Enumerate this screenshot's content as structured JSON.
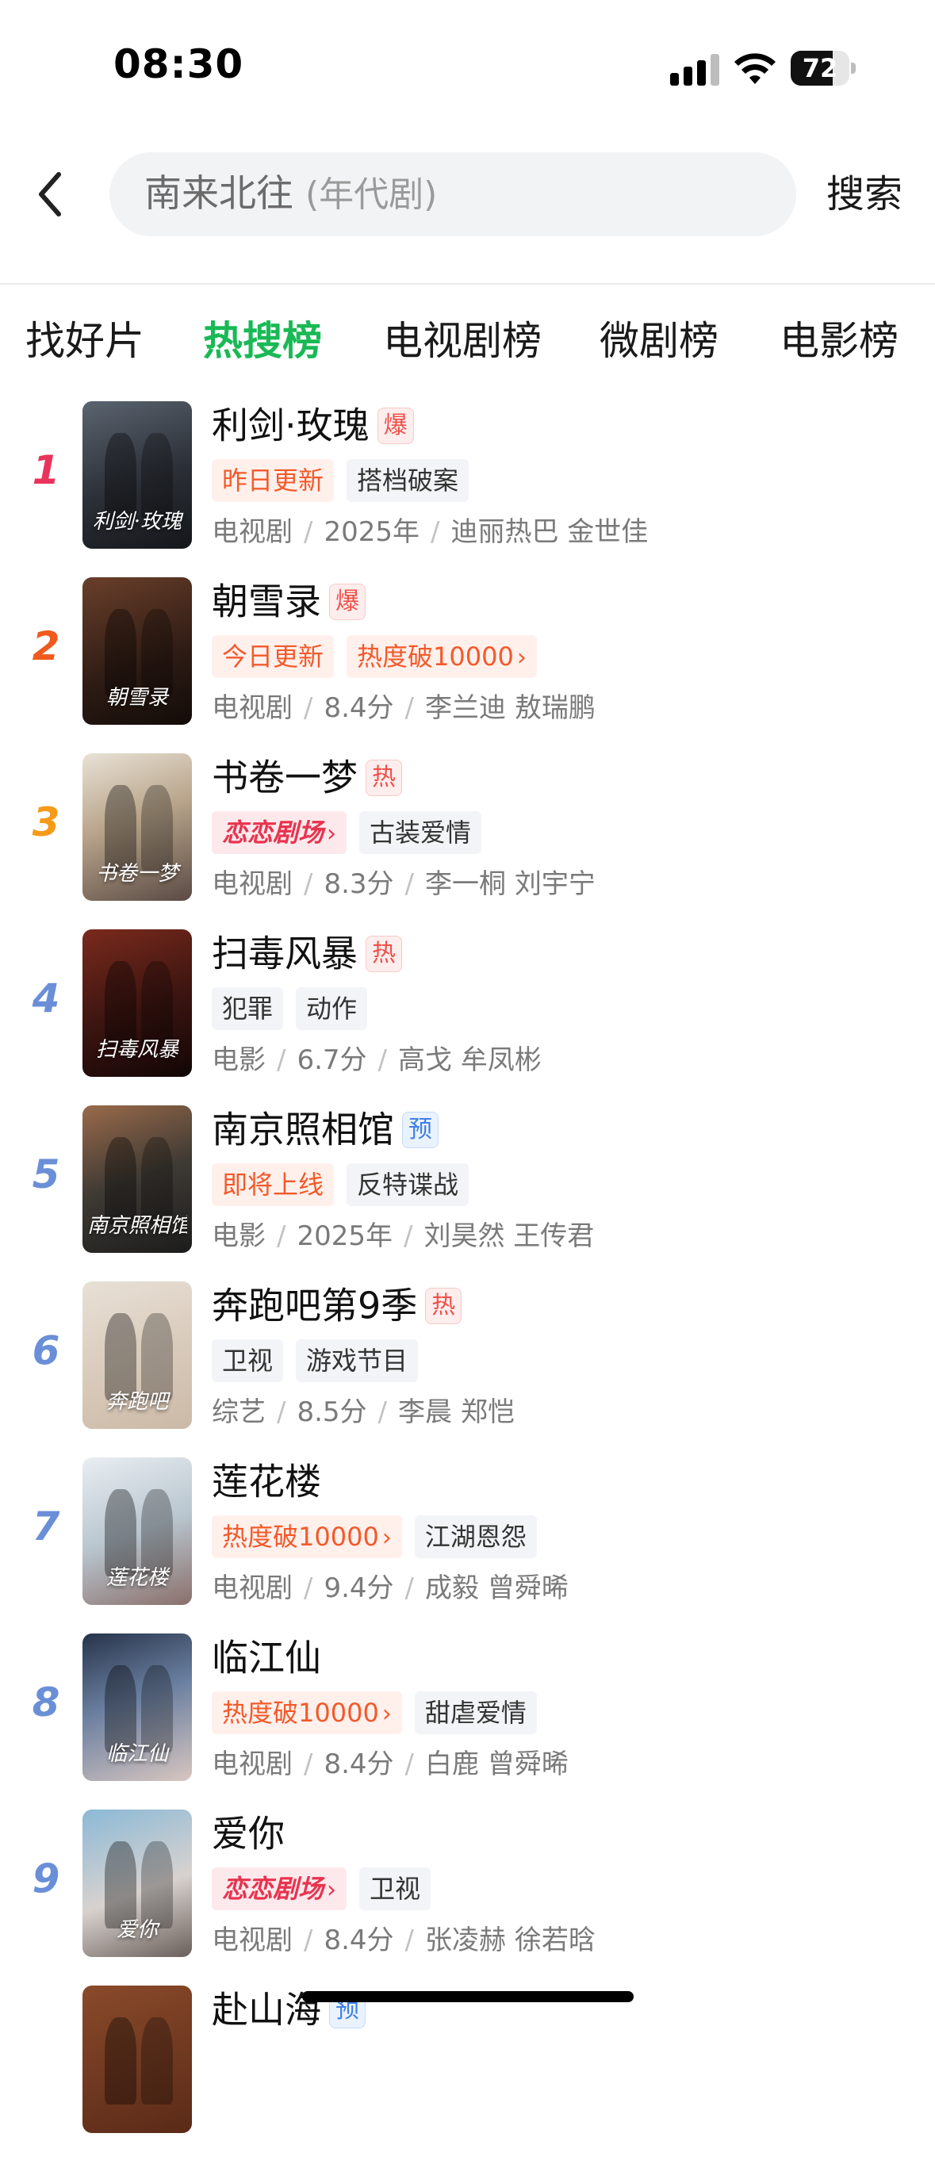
{
  "status_bar": {
    "time": "08:30",
    "battery": "72",
    "battery_level": 0.72
  },
  "search": {
    "value": "南来北往",
    "hint": "(年代剧)",
    "button_label": "搜索"
  },
  "tabs": [
    {
      "label": "找好片",
      "active": false
    },
    {
      "label": "热搜榜",
      "active": true
    },
    {
      "label": "电视剧榜",
      "active": false
    },
    {
      "label": "微剧榜",
      "active": false
    },
    {
      "label": "电影榜",
      "active": false
    }
  ],
  "colors": {
    "active_tab": "#19b955",
    "rank_1": "#e8345c",
    "rank_2": "#f05a1e",
    "rank_3": "#f59a1a",
    "rank_other": "#6a8fd8",
    "tag_red": "#f25a2a",
    "badge_hot": "#f0504a",
    "badge_pre": "#3f7fe6"
  },
  "list": [
    {
      "rank": "1",
      "title": "利剑·玫瑰",
      "badge": "爆",
      "badge_type": "hot",
      "tags": [
        {
          "text": "昨日更新",
          "style": "red"
        },
        {
          "text": "搭档破案",
          "style": "grey"
        }
      ],
      "meta": [
        "电视剧",
        "2025年",
        "迪丽热巴 金世佳"
      ],
      "poster_text": "利剑·玫瑰"
    },
    {
      "rank": "2",
      "title": "朝雪录",
      "badge": "爆",
      "badge_type": "hot",
      "tags": [
        {
          "text": "今日更新",
          "style": "red"
        },
        {
          "text": "热度破10000",
          "style": "red",
          "chevron": true
        }
      ],
      "meta": [
        "电视剧",
        "8.4分",
        "李兰迪 敖瑞鹏"
      ],
      "poster_text": "朝雪录"
    },
    {
      "rank": "3",
      "title": "书卷一梦",
      "badge": "热",
      "badge_type": "hot",
      "tags": [
        {
          "text": "恋恋剧场",
          "style": "love",
          "chevron": true
        },
        {
          "text": "古装爱情",
          "style": "grey"
        }
      ],
      "meta": [
        "电视剧",
        "8.3分",
        "李一桐 刘宇宁"
      ],
      "poster_text": "书卷一梦"
    },
    {
      "rank": "4",
      "title": "扫毒风暴",
      "badge": "热",
      "badge_type": "hot",
      "tags": [
        {
          "text": "犯罪",
          "style": "grey"
        },
        {
          "text": "动作",
          "style": "grey"
        }
      ],
      "meta": [
        "电影",
        "6.7分",
        "高戈 牟凤彬"
      ],
      "poster_text": "扫毒风暴"
    },
    {
      "rank": "5",
      "title": "南京照相馆",
      "badge": "预",
      "badge_type": "pre",
      "tags": [
        {
          "text": "即将上线",
          "style": "red"
        },
        {
          "text": "反特谍战",
          "style": "grey"
        }
      ],
      "meta": [
        "电影",
        "2025年",
        "刘昊然 王传君"
      ],
      "poster_text": "南京照相馆"
    },
    {
      "rank": "6",
      "title": "奔跑吧第9季",
      "badge": "热",
      "badge_type": "hot",
      "tags": [
        {
          "text": "卫视",
          "style": "grey"
        },
        {
          "text": "游戏节目",
          "style": "grey"
        }
      ],
      "meta": [
        "综艺",
        "8.5分",
        "李晨 郑恺"
      ],
      "poster_text": "奔跑吧"
    },
    {
      "rank": "7",
      "title": "莲花楼",
      "badge": "",
      "badge_type": "",
      "tags": [
        {
          "text": "热度破10000",
          "style": "red",
          "chevron": true
        },
        {
          "text": "江湖恩怨",
          "style": "grey"
        }
      ],
      "meta": [
        "电视剧",
        "9.4分",
        "成毅 曾舜晞"
      ],
      "poster_text": "莲花楼"
    },
    {
      "rank": "8",
      "title": "临江仙",
      "badge": "",
      "badge_type": "",
      "tags": [
        {
          "text": "热度破10000",
          "style": "red",
          "chevron": true
        },
        {
          "text": "甜虐爱情",
          "style": "grey"
        }
      ],
      "meta": [
        "电视剧",
        "8.4分",
        "白鹿 曾舜晞"
      ],
      "poster_text": "临江仙"
    },
    {
      "rank": "9",
      "title": "爱你",
      "badge": "",
      "badge_type": "",
      "tags": [
        {
          "text": "恋恋剧场",
          "style": "love",
          "chevron": true
        },
        {
          "text": "卫视",
          "style": "grey"
        }
      ],
      "meta": [
        "电视剧",
        "8.4分",
        "张凌赫 徐若晗"
      ],
      "poster_text": "爱你"
    },
    {
      "rank": "",
      "title": "赴山海",
      "badge": "预",
      "badge_type": "pre",
      "tags": [],
      "meta": [],
      "poster_text": ""
    }
  ]
}
